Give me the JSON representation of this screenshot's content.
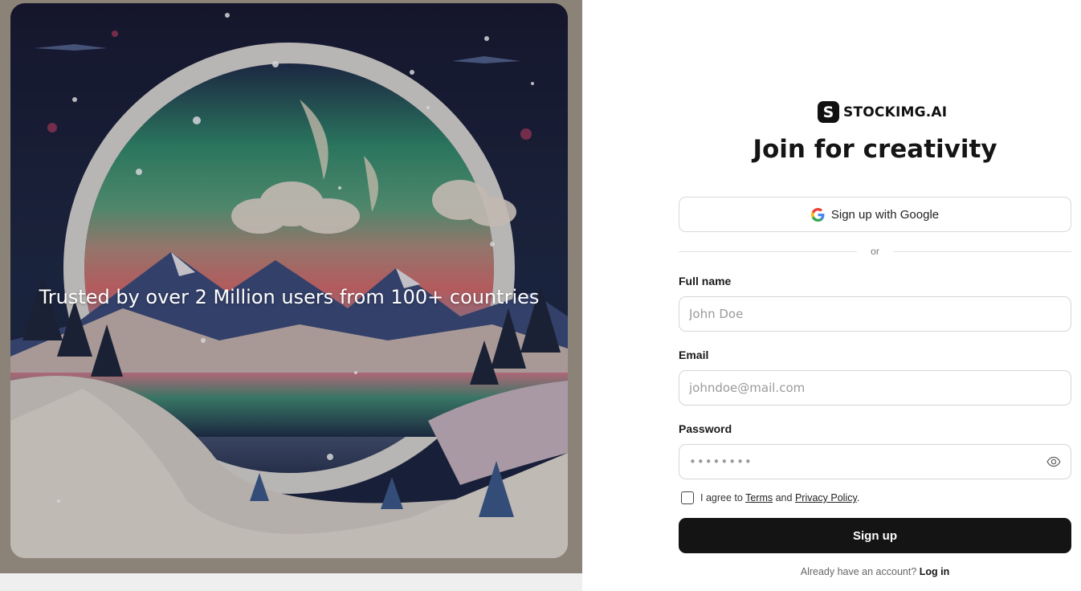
{
  "left_panel": {
    "tagline": "Trusted by over 2 Million users from 100+ countries"
  },
  "brand": {
    "logo_letter": "S",
    "name": "STOCKIMG.AI"
  },
  "headline": "Join for creativity",
  "google_button": {
    "label": "Sign up with Google",
    "icon": "google-icon"
  },
  "divider": {
    "text": "or"
  },
  "form": {
    "full_name": {
      "label": "Full name",
      "placeholder": "John Doe",
      "value": ""
    },
    "email": {
      "label": "Email",
      "placeholder": "johndoe@mail.com",
      "value": ""
    },
    "password": {
      "label": "Password",
      "placeholder": "••••••••",
      "value": "",
      "toggle_icon": "eye-icon"
    },
    "agree": {
      "prefix": "I agree to",
      "terms": "Terms",
      "and": "and",
      "privacy": "Privacy Policy",
      "suffix": ".",
      "checked": false
    },
    "submit_label": "Sign up"
  },
  "login_prompt": {
    "text": "Already have an account?",
    "link": "Log in"
  },
  "colors": {
    "primary_button": "#141414",
    "border": "#d6d6d6"
  }
}
